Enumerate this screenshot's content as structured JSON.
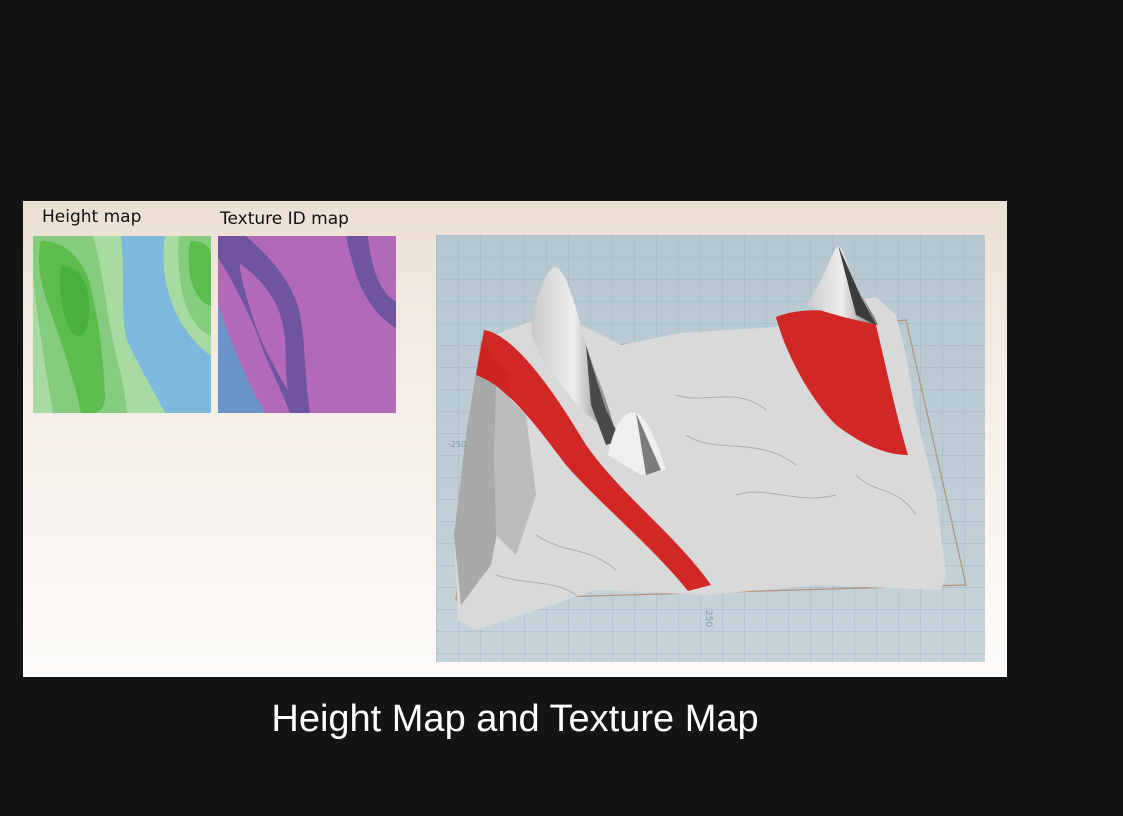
{
  "panels": {
    "height_map_label": "Height map",
    "texture_map_label": "Texture  ID map"
  },
  "render": {
    "axis_labels": [
      "250",
      "-250"
    ]
  },
  "caption": "Height Map and Texture Map",
  "colors": {
    "background": "#141414",
    "height_water": "#7fb8dd",
    "height_low": "#a8dba2",
    "height_mid": "#86cc7e",
    "height_high": "#5cbd4e",
    "texture_purple": "#b26ab8",
    "texture_violet": "#6f54a0",
    "texture_blue": "#6b94cb",
    "terrain_grey": "#d8d8d8",
    "terrain_red": "#d21b1b",
    "grid": "#9fb4bf"
  }
}
